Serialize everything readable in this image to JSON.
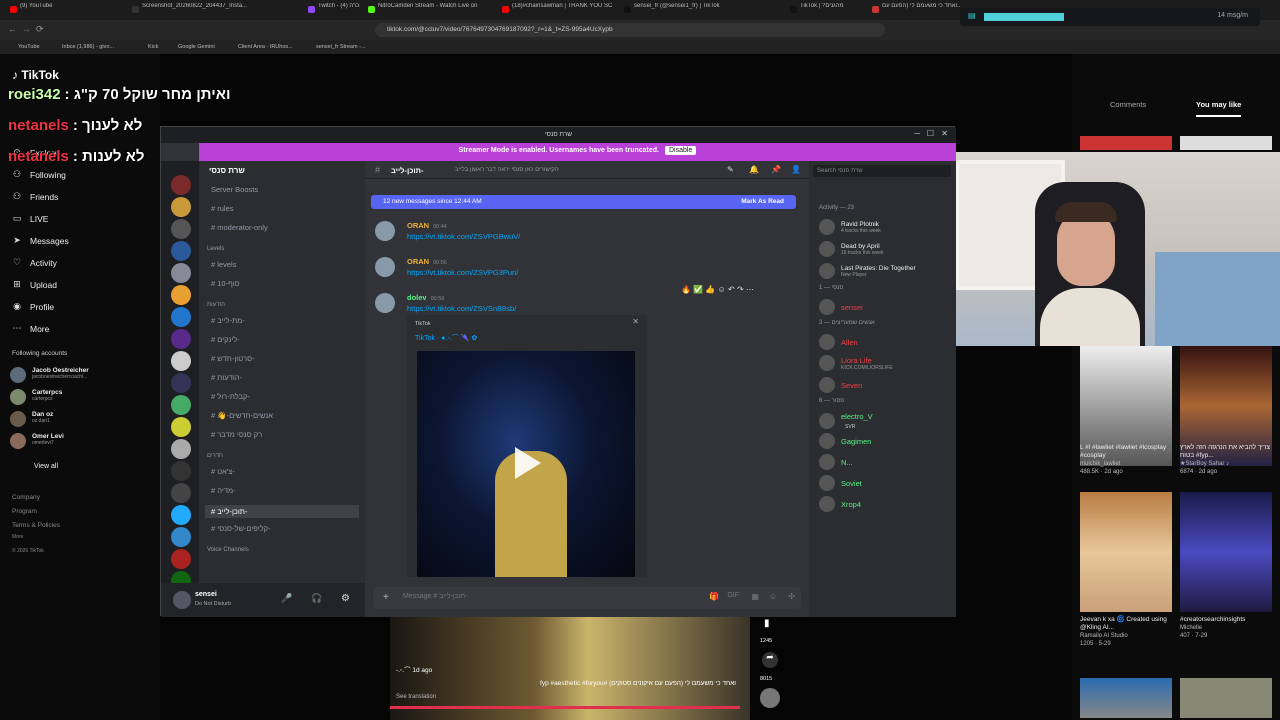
{
  "browser": {
    "tabs": [
      "(9) YouTube",
      "Screenshot_20260822_204437_Insta...",
      "Twitch - הכרה (4)",
      "NitroCamden Stream - Watch Live on",
      "(18)#chainsawman | THANK YOU SC",
      "sensei_fr (@sensei1_fr) | TikTok",
      "TikTok | ?מהגנים",
      "ואחד כי משעמם לי (הפעם עם..."
    ],
    "url": "tiktok.com/@ccluv7/video/7676497304769187092?_r=1&_t=ZS-995a4UcXypb",
    "bookmarks": [
      "YouTube",
      "Inbox (1,986) - givo...",
      "Kick",
      "Google Gemini",
      "Client Area - IRUhos...",
      "sensei_fr Stream -..."
    ],
    "stream_stat": "14 msg/m"
  },
  "tiktok": {
    "logo": "TikTok",
    "nav": [
      {
        "icon": "compass-icon",
        "label": "Explore"
      },
      {
        "icon": "users-icon",
        "label": "Following"
      },
      {
        "icon": "friends-icon",
        "label": "Friends"
      },
      {
        "icon": "live-icon",
        "label": "LIVE"
      },
      {
        "icon": "send-icon",
        "label": "Messages"
      },
      {
        "icon": "bell-icon",
        "label": "Activity"
      },
      {
        "icon": "upload-icon",
        "label": "Upload"
      },
      {
        "icon": "profile-icon",
        "label": "Profile"
      },
      {
        "icon": "more-icon",
        "label": "More"
      }
    ],
    "following_header": "Following accounts",
    "following": [
      {
        "name": "Jacob Oestreicher",
        "handle": "jacoboestreichercoachl..."
      },
      {
        "name": "Carterpcs",
        "handle": "carterpcs"
      },
      {
        "name": "Dan oz",
        "handle": "oz.dan1"
      },
      {
        "name": "Omer Levi",
        "handle": "omerlevi7"
      }
    ],
    "view_all": "View all",
    "footer": [
      "Company",
      "Program",
      "Terms & Policies",
      "More",
      "© 2026 TikTok"
    ],
    "right_tabs": [
      "Comments",
      "You may like"
    ],
    "feed": [
      {
        "title": "L #l #lawliet #lawliet #lcosplay #cosplay",
        "user": "muichik_lawliet",
        "stats": "488.5K · 2d ago"
      },
      {
        "title": "צריך להביא את הנרגזה הזה לארץ בטוח #fyp...",
        "user": "★StarBoy Sahar ♪",
        "stats": "6874 · 2d ago"
      },
      {
        "title": "",
        "user": "",
        "stats": ""
      },
      {
        "title": "#creatorsearchinsights",
        "user": "Michelle",
        "stats": "407 · 7-29"
      },
      {
        "title": "Jeevan k xa 🌀 Created using @Kling AI...",
        "user": "Ramailo AI Studio",
        "stats": "1205 · 5-29"
      }
    ],
    "video_caption": "ואחד כי משעמם לי (הפעם עם איקונים סטוקים) #fyp #aesthetic #foryou",
    "video_user": "-.◦.⌒ 1d ago",
    "see_translation": "See translation",
    "side_stats": [
      "1245",
      "8015"
    ]
  },
  "chat_overlay": [
    {
      "user": "roei342",
      "text": ": ואיתן מחר שוקל 70 ק\"ג"
    },
    {
      "user": "netanels",
      "text": ": לא לענוך"
    },
    {
      "user": "netanels",
      "text": ": לא לענות"
    }
  ],
  "discord": {
    "window_title": "שרת סנסי",
    "streamer_mode": "Streamer Mode is enabled. Usernames have been truncated.",
    "disable_label": "Disable",
    "server_name": "שרת סנסי",
    "channels": [
      {
        "label": "Server Boosts",
        "type": "boost"
      },
      {
        "label": "rules",
        "type": "text"
      },
      {
        "label": "moderator-only",
        "type": "text"
      },
      {
        "label": "Levels",
        "type": "category"
      },
      {
        "label": "levels",
        "type": "text"
      },
      {
        "label": "10-סוף",
        "type": "text"
      },
      {
        "label": "הודעות",
        "type": "category"
      },
      {
        "label": "מת-לייב-",
        "type": "text"
      },
      {
        "label": "לינקים-",
        "type": "text"
      },
      {
        "label": "סרטון-חדש-",
        "type": "text"
      },
      {
        "label": "הודעות-",
        "type": "text"
      },
      {
        "label": "קבלת-רול-",
        "type": "text"
      },
      {
        "label": "👋-אנשים-חדשים",
        "type": "text"
      },
      {
        "label": "רק סנסי מדבר",
        "type": "text"
      },
      {
        "label": "חדרים",
        "type": "category"
      },
      {
        "label": "צ'אט-",
        "type": "text"
      },
      {
        "label": "מדיה-",
        "type": "text"
      },
      {
        "label": "תוכן-לייב-",
        "type": "text",
        "selected": true
      },
      {
        "label": "קליפים-של-סנסי-",
        "type": "text"
      },
      {
        "label": "Voice Channels",
        "type": "category"
      }
    ],
    "current_channel": "תוכן-לייב-",
    "channel_topic": "הקישורים כאן סנסי יראה דבר ראשון בלייב",
    "search_placeholder": "Search שרת סנסי",
    "new_messages": "12 new messages since 12:44 AM",
    "mark_as_read": "Mark As Read",
    "messages": [
      {
        "author": "ORAN",
        "time": "00:44",
        "link": "https://vt.tiktok.com/ZSVPGBwuV/",
        "color": "#f0b232"
      },
      {
        "author": "ORAN",
        "time": "00:56",
        "link": "https://vt.tiktok.com/ZSVPG3Pun/",
        "color": "#f0b232"
      },
      {
        "author": "dolev",
        "time": "00:59",
        "link": "https://vt.tiktok.com/ZSVSnB8sb/",
        "color": "#57f287"
      }
    ],
    "embed_provider": "TikTok",
    "embed_title": "TikTok · ●.◦.⌒ 🌂 ✿",
    "message_placeholder": "Message # תוכן-לייב-",
    "user": {
      "name": "sensei",
      "status": "Do Not Disturb"
    },
    "members": [
      {
        "type": "header",
        "label": "Activity — 23"
      },
      {
        "type": "activity",
        "name": "Ravid Plotnik",
        "sub": "4 tracks this week"
      },
      {
        "type": "activity",
        "name": "Dead by April",
        "sub": "16 tracks this week"
      },
      {
        "type": "activity",
        "name": "Last Pirates: Die Together",
        "sub": "New Player"
      },
      {
        "type": "header",
        "label": "סנסי — 1"
      },
      {
        "type": "member",
        "name": "sensei",
        "color": "#f23f43"
      },
      {
        "type": "header",
        "label": "אנשים שמעריצים — 3"
      },
      {
        "type": "member",
        "name": "Allen",
        "color": "#f23f43"
      },
      {
        "type": "member",
        "name": "Liora Life",
        "color": "#f23f43",
        "sub": "KICK.COM/LIORSLIFE"
      },
      {
        "type": "member",
        "name": "Seven",
        "color": "#f23f43"
      },
      {
        "type": "header",
        "label": "פסור — 6"
      },
      {
        "type": "member",
        "name": "electro_V",
        "color": "#57f287",
        "tag": "SVR"
      },
      {
        "type": "member",
        "name": "Gagimen",
        "color": "#57f287"
      },
      {
        "type": "member",
        "name": "N...",
        "color": "#57f287"
      },
      {
        "type": "member",
        "name": "Soviet",
        "color": "#57f287"
      },
      {
        "type": "member",
        "name": "Xrop4",
        "color": "#57f287"
      }
    ]
  }
}
